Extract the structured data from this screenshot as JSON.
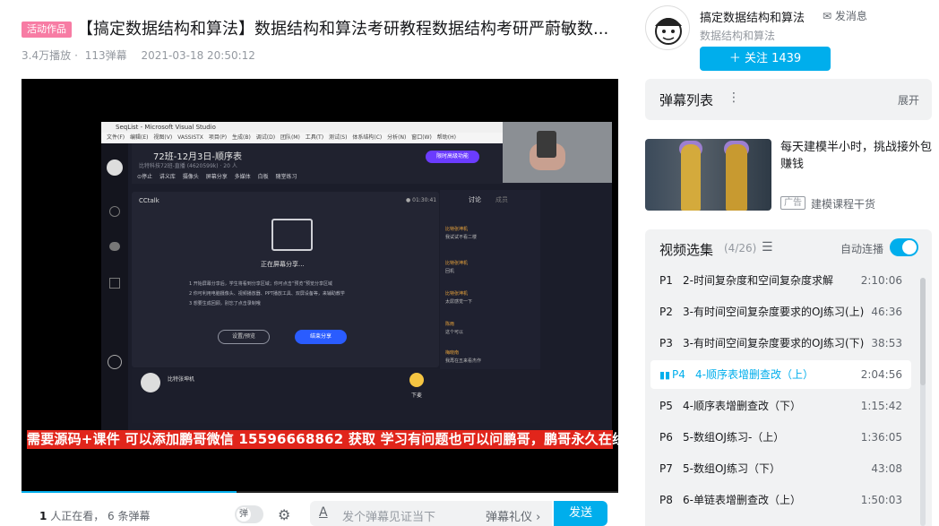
{
  "video": {
    "tag": "活动作品",
    "title": "【搞定数据结构和算法】数据结构和算法考研教程数据结构考研严蔚敏数...",
    "plays": "3.4万播放",
    "danmaku": "113弹幕",
    "date": "2021-03-18 20:50:12",
    "progress_fraction": 0.36
  },
  "screen": {
    "window_title": "SeqList - Microsoft Visual Studio",
    "menu": "文件(F) 编辑(E) 视图(V) VASSISTX 项目(P) 生成(B) 调试(D) 团队(M) 工具(T) 测试(S) 体系结构(C) 分析(N) 窗口(W) 帮助(H)",
    "class_title": "72班-12月3日-顺序表",
    "class_sub": "比特科技72班-直播 (4620599k) · 20 人",
    "tools": "⊙停止  讲义库  摄像头  屏幕分享  多媒体  白板  随堂练习",
    "upgrade": "限时高级功能",
    "app_name": "CCtalk",
    "timer": "● 01:30:41",
    "sharing": "正在屏幕分享...",
    "steps": [
      "1 开始屏幕分享后，学生将看到分享区域；你可点击“预览”预览分享区域",
      "2 你可利用电脑摄像头、视频播放器、PPT播放工具、双屏设备等，来辅助教学",
      "3 想要生成回顾，别忘了点击录制哦"
    ],
    "btn_preview": "设置/预览",
    "btn_end": "结束分享",
    "tab_discuss": "讨论",
    "tab_members": "成员",
    "chats": [
      {
        "user": "比特张坤机",
        "text": "我试试不看二楼"
      },
      {
        "user": "比特张坤机",
        "text": "回机"
      },
      {
        "user": "比特张坤机",
        "text": "太屌感觉一下"
      },
      {
        "user": "陈雨",
        "text": "这个可以"
      },
      {
        "user": "梅晓南",
        "text": "我再在五来看杰作"
      }
    ],
    "teacher": "比特张坤机",
    "pen_label": "下麦"
  },
  "banner": "需要源码+课件 可以添加鹏哥微信 15596668862 获取 学习有问题也可以问鹏哥，鹏哥永久在线",
  "bottom": {
    "watching_count": "1",
    "watching_text": "人正在看，",
    "danmaku_count": "6",
    "danmaku_text": "条弹幕",
    "toggle_label": "弹",
    "input_placeholder": "发个弹幕见证当下",
    "etiquette": "弹幕礼仪 ›",
    "send": "发送",
    "a_icon": "A"
  },
  "uploader": {
    "name": "搞定数据结构和算法",
    "message": "发消息",
    "desc": "数据结构和算法",
    "follow": "＋  关注 1439"
  },
  "danmaku_list": {
    "title": "弹幕列表",
    "dots": "⋮",
    "expand": "展开"
  },
  "ad": {
    "title": "每天建模半小时，挑战接外包赚钱",
    "tag": "广告",
    "source": "建模课程干货"
  },
  "episodes": {
    "title": "视频选集",
    "count": "(4/26)",
    "autoplay": "自动连播",
    "items": [
      {
        "p": "P1",
        "name": "2-时间复杂度和空间复杂度求解",
        "dur": "2:10:06"
      },
      {
        "p": "P2",
        "name": "3-有时间空间复杂度要求的OJ练习(上)",
        "dur": "46:36"
      },
      {
        "p": "P3",
        "name": "3-有时间空间复杂度要求的OJ练习(下)",
        "dur": "38:53"
      },
      {
        "p": "P4",
        "name": "4-顺序表增删查改（上）",
        "dur": "2:04:56"
      },
      {
        "p": "P5",
        "name": "4-顺序表增删查改（下）",
        "dur": "1:15:42"
      },
      {
        "p": "P6",
        "name": "5-数组OJ练习-（上）",
        "dur": "1:36:05"
      },
      {
        "p": "P7",
        "name": "5-数组OJ练习（下）",
        "dur": "43:08"
      },
      {
        "p": "P8",
        "name": "6-单链表增删查改（上）",
        "dur": "1:50:03"
      }
    ]
  }
}
